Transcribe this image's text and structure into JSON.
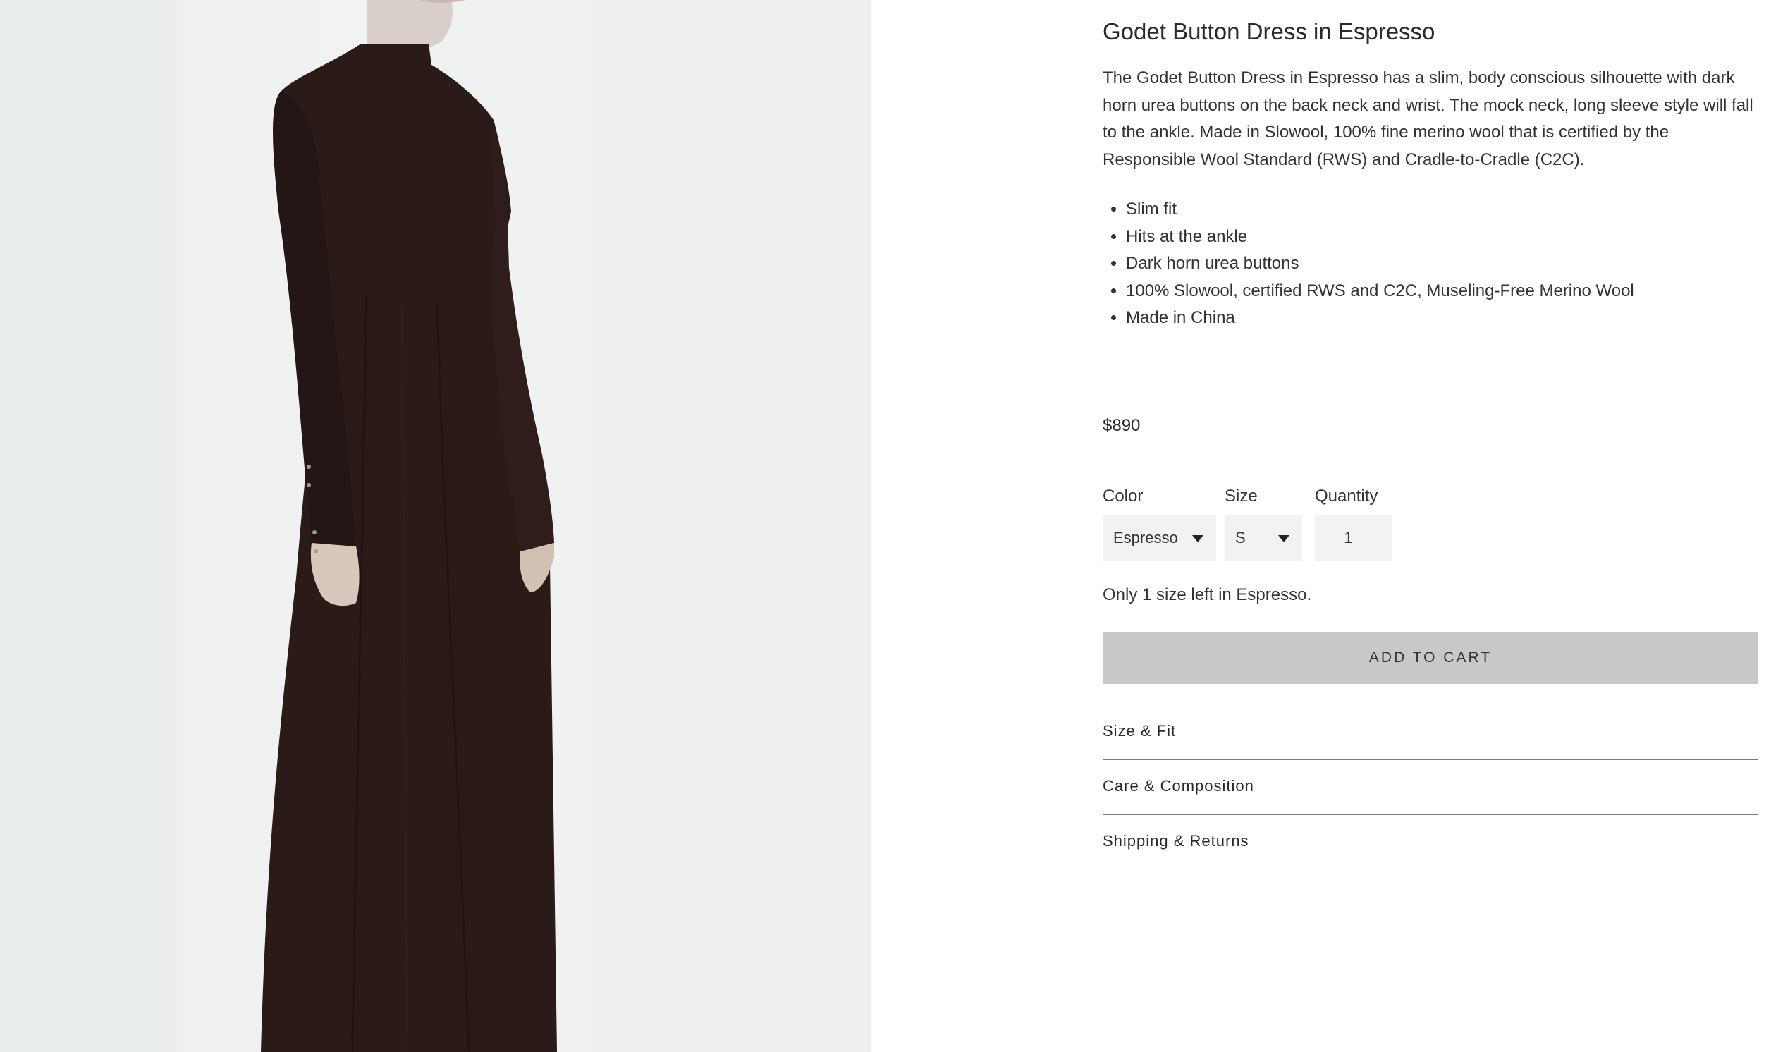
{
  "product": {
    "title": "Godet Button Dress in Espresso",
    "description": "The Godet Button Dress in Espresso has a slim, body conscious silhouette with dark horn urea buttons on the back neck and wrist. The mock neck, long sleeve style will fall to the ankle. Made in Slowool, 100% fine merino wool that is certified by the Responsible Wool Standard (RWS) and Cradle-to-Cradle (C2C).",
    "features": [
      "Slim fit",
      "Hits at the ankle",
      "Dark horn urea buttons",
      "100% Slowool, certified RWS and C2C, Museling-Free Merino Wool",
      "Made in China"
    ],
    "price": "$890",
    "image_colors": {
      "background": "#eef0f0",
      "dress": "#2a1a18"
    }
  },
  "options": {
    "color": {
      "label": "Color",
      "value": "Espresso"
    },
    "size": {
      "label": "Size",
      "value": "S"
    },
    "quantity": {
      "label": "Quantity",
      "value": "1"
    }
  },
  "stock_note": "Only 1 size left in Espresso.",
  "cart": {
    "button_label": "ADD TO CART",
    "button_color": "#c8c8c8"
  },
  "accordion": {
    "size_fit": "Size & Fit",
    "care": "Care & Composition",
    "shipping": "Shipping & Returns"
  }
}
